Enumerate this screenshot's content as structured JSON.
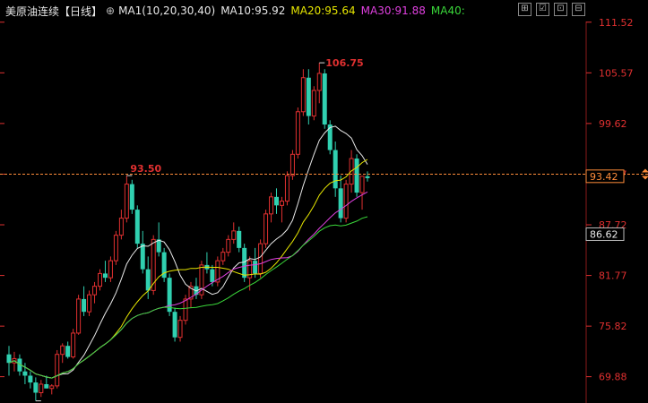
{
  "header": {
    "symbol": "美原油连续",
    "period": "【日线】",
    "gear_icon": "gear-icon",
    "ma1": "MA1(10,20,30,40)",
    "ma10": "MA10:95.92",
    "ma20": "MA20:95.64",
    "ma30": "MA30:91.88",
    "ma40": "MA40:"
  },
  "toolbar": {
    "icons": [
      "grid-icon",
      "checkbox-icon",
      "crosshair-icon",
      "minus-icon"
    ],
    "glyphs": [
      "⊞",
      "☑",
      "⊡",
      "⊟"
    ]
  },
  "colors": {
    "up": "#e03030",
    "down": "#30d0b0",
    "ma10": "#e8e8e8",
    "ma20": "#e6e600",
    "ma30": "#e040e0",
    "ma40": "#3ad83a",
    "axis_text": "#e03030",
    "current": "#ff8c3a"
  },
  "axis": {
    "ticks": [
      "111.52",
      "105.57",
      "99.62",
      "93.67",
      "87.72",
      "81.77",
      "75.82",
      "69.88"
    ],
    "current_price": "93.42",
    "marker_price": "86.62"
  },
  "chart_data": {
    "type": "candlestick",
    "ylim": [
      67.0,
      111.6
    ],
    "annotations": {
      "high": "106.75",
      "mid_high": "93.50",
      "low": "67.04"
    },
    "candles": [
      [
        72.5,
        73.5,
        70.0,
        71.5
      ],
      [
        71.5,
        72.8,
        70.5,
        72.0
      ],
      [
        72.0,
        72.5,
        70.0,
        70.5
      ],
      [
        70.5,
        71.5,
        69.0,
        70.0
      ],
      [
        70.0,
        70.5,
        68.5,
        69.2
      ],
      [
        69.2,
        69.8,
        67.04,
        68.0
      ],
      [
        68.0,
        69.5,
        67.5,
        69.0
      ],
      [
        69.0,
        70.0,
        68.5,
        68.5
      ],
      [
        68.5,
        69.0,
        67.8,
        68.8
      ],
      [
        68.8,
        73.0,
        68.5,
        72.5
      ],
      [
        72.5,
        73.8,
        71.5,
        73.5
      ],
      [
        73.5,
        74.0,
        72.0,
        72.2
      ],
      [
        72.2,
        75.5,
        72.0,
        75.0
      ],
      [
        75.0,
        79.5,
        74.8,
        79.0
      ],
      [
        79.0,
        80.5,
        77.0,
        77.5
      ],
      [
        77.5,
        80.0,
        77.0,
        79.5
      ],
      [
        79.5,
        81.0,
        78.5,
        80.5
      ],
      [
        80.5,
        82.5,
        80.0,
        82.0
      ],
      [
        82.0,
        83.5,
        81.0,
        81.5
      ],
      [
        81.5,
        84.0,
        81.0,
        83.5
      ],
      [
        83.5,
        87.0,
        83.0,
        86.5
      ],
      [
        86.5,
        89.5,
        86.0,
        88.5
      ],
      [
        88.5,
        93.5,
        88.0,
        92.5
      ],
      [
        92.5,
        93.0,
        89.0,
        89.5
      ],
      [
        89.5,
        90.0,
        85.0,
        85.5
      ],
      [
        85.5,
        87.0,
        82.0,
        82.5
      ],
      [
        82.5,
        84.0,
        79.0,
        80.0
      ],
      [
        80.0,
        86.5,
        79.5,
        86.0
      ],
      [
        86.0,
        88.0,
        84.0,
        84.5
      ],
      [
        84.5,
        85.0,
        81.0,
        81.5
      ],
      [
        81.5,
        82.0,
        77.0,
        77.5
      ],
      [
        77.5,
        78.0,
        74.0,
        74.5
      ],
      [
        74.5,
        77.0,
        74.0,
        76.5
      ],
      [
        76.5,
        79.5,
        76.0,
        79.0
      ],
      [
        79.0,
        81.0,
        78.0,
        80.5
      ],
      [
        80.5,
        81.5,
        79.0,
        79.5
      ],
      [
        79.5,
        83.5,
        79.0,
        83.0
      ],
      [
        83.0,
        84.5,
        82.0,
        82.5
      ],
      [
        82.5,
        83.0,
        80.5,
        81.0
      ],
      [
        81.0,
        84.0,
        80.5,
        83.5
      ],
      [
        83.5,
        85.0,
        83.0,
        84.5
      ],
      [
        84.5,
        86.5,
        84.0,
        86.0
      ],
      [
        86.0,
        88.0,
        85.5,
        87.0
      ],
      [
        87.0,
        87.5,
        84.5,
        85.0
      ],
      [
        85.0,
        85.5,
        81.0,
        81.5
      ],
      [
        81.5,
        84.0,
        80.0,
        83.5
      ],
      [
        83.5,
        85.0,
        81.5,
        82.0
      ],
      [
        82.0,
        86.0,
        81.5,
        85.5
      ],
      [
        85.5,
        89.5,
        85.0,
        89.0
      ],
      [
        89.0,
        91.5,
        88.0,
        91.0
      ],
      [
        91.0,
        92.0,
        89.0,
        90.0
      ],
      [
        90.0,
        91.0,
        88.0,
        90.5
      ],
      [
        90.5,
        94.0,
        90.0,
        93.5
      ],
      [
        93.5,
        96.5,
        93.0,
        96.0
      ],
      [
        96.0,
        101.5,
        95.5,
        101.0
      ],
      [
        101.0,
        106.0,
        100.5,
        105.0
      ],
      [
        105.0,
        106.0,
        99.5,
        100.5
      ],
      [
        100.5,
        104.0,
        100.0,
        103.5
      ],
      [
        103.5,
        106.75,
        102.0,
        105.5
      ],
      [
        105.5,
        106.0,
        99.0,
        99.5
      ],
      [
        99.5,
        100.0,
        96.0,
        96.5
      ],
      [
        96.5,
        97.5,
        91.0,
        92.0
      ],
      [
        92.0,
        93.5,
        88.0,
        88.5
      ],
      [
        88.5,
        93.0,
        88.0,
        92.5
      ],
      [
        92.5,
        96.5,
        91.5,
        95.5
      ],
      [
        95.5,
        96.0,
        91.0,
        91.5
      ],
      [
        91.5,
        93.0,
        89.5,
        93.42
      ],
      [
        93.42,
        94.0,
        92.8,
        93.2
      ]
    ]
  }
}
